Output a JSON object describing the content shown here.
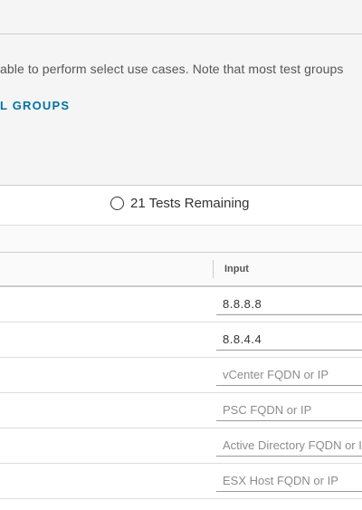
{
  "description": {
    "text": "able to perform select use cases. Note that most test groups",
    "link": "L GROUPS"
  },
  "status": {
    "text": "21 Tests Remaining"
  },
  "table": {
    "header_input": "Input",
    "rows": [
      {
        "value": "8.8.8.8",
        "placeholder": ""
      },
      {
        "value": "8.8.4.4",
        "placeholder": ""
      },
      {
        "value": "",
        "placeholder": "vCenter FQDN or IP"
      },
      {
        "value": "",
        "placeholder": "PSC FQDN or IP"
      },
      {
        "value": "",
        "placeholder": "Active Directory FQDN or IP"
      },
      {
        "value": "",
        "placeholder": "ESX Host FQDN or IP"
      }
    ]
  },
  "colors": {
    "link": "#0072a3",
    "panel_bg": "#f5f5f5"
  }
}
